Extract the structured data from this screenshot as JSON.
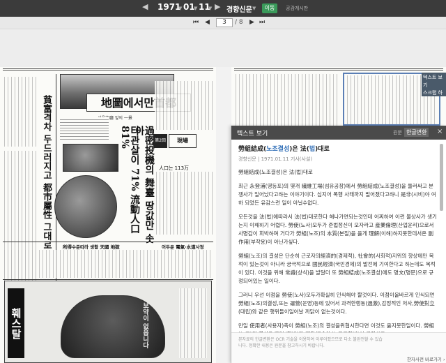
{
  "toolbar": {
    "year": "1971",
    "month": "01",
    "day": "11",
    "newspaper": "경향신문",
    "move_label": "이동",
    "public_link": "공감게시판"
  },
  "pager": {
    "current": "3",
    "total": "/ 8"
  },
  "newspaper_page": {
    "headline_map": "地圖에서만首都",
    "caption_map": "서울市廳 앞의 一景",
    "headline_left1": "貧富격차 두드러지고 都市屬性 그대로",
    "headline_center1": "타관살이 71% 流動人口 81%",
    "headline_center2": "過密投機의 舞臺 땅값만 솟아",
    "box_label": "第2回",
    "box_label2": "現場",
    "figure_label": "人口는 113万",
    "photo_caption": "所得수준따라 생활 天國 地獄",
    "bottom_caption": "어두운 電氣·水道사정",
    "ad_brand": "훼스탈",
    "ad_copy": "보약이 없읍니다"
  },
  "text_panel": {
    "title": "텍스트 보기",
    "original_label": "원문",
    "hanja_label": "한글변환",
    "close": "×",
    "article_title_pre": "勞組結成(",
    "article_title_hl1": "노조결성",
    "article_title_mid": ")은 法(",
    "article_title_hl2": "법",
    "article_title_post": ")대로",
    "meta": "경향신문 | 1971.01.11 기사(사설)",
    "para0": "勞組結成(노조결성)은 法(법)대로",
    "para1": "최근 永登浦(영등포)의 몇개 繊維工場(섬유공장)에서 勞組結成(노조결성)을 둘러싸고 분쟁사가 일어났다고하는 이야기이다. 심지어 폭행 사태까지 벌어졌다고하니 是非(시비)야 여하 되었든 유감스런 일이 아닐수없다.",
    "para2": "모든것을 法(법)에따라서 法(법)대로한다 해나가면되는것인데 어찌하여 이런 불상사가 생기는지 이해하기 어렵다. 勞使(노사)모두가 준법정신이 모자라고 産業倫理(산업윤리)으로서 사명감이 희박하며 거다가 勞組(노조)의 本質(본질)을 옳게 理解(이해)하지못한데서온 副作用(부작용)이 아닌가싶다.",
    "para3": "勞組(노조)의 결성은 단순히 근로자의經濟的(경제적), 社會的(사회적)지위의 향상에만 목적이 있는것이 아니라 궁극적으로 國民經濟(국민경제)의 발전에 기여한다고 하는데도 목적이 있다. 이것을 위해 常識(상식)을 발달더 또 勞組結成(노조결성)에도 명文(명문)으로 규정되어있는 일이다.",
    "para4": "그러니 우선 이점을 勞使(노사)모두가확실히 인식해야 할것이다. 이점이올바르게 인식되면 勞組(노조)의결성,또는 運營(운영)등에 있어서 과격한행동(過激),감정적인 처사,勞使對立(대립)와 같은 행위들이일어날 까닭이 없는것이다.",
    "para5": "만일 使用者(사용자)측이 勞組(노조)의 결성을위협시한다면 이것도 옳지못한일이다. 勞組(노조)의 결성은 憲法(헌법)과 勞動組合法(노동조합법)이 규정하고",
    "footnote": "본자료의 한글변환은 OCR 기술을 이용하여 이루어졌으므로 다소 불완전할 수 있습니다. 정확한 내용은 원문을 참고하시기 바랍니다.",
    "report_link": "한자사전 바로가기 ›"
  },
  "side_tab": {
    "line1": "텍스트 보기",
    "line2": "스크랩 하기"
  }
}
